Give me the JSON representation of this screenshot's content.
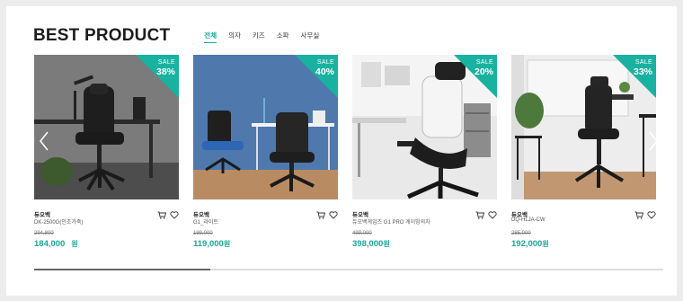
{
  "section": {
    "title": "BEST PRODUCT"
  },
  "tabs": [
    {
      "label": "전체",
      "active": true
    },
    {
      "label": "의자",
      "active": false
    },
    {
      "label": "키즈",
      "active": false
    },
    {
      "label": "소파",
      "active": false
    },
    {
      "label": "사무실",
      "active": false
    }
  ],
  "products": [
    {
      "sale_label": "SALE",
      "sale_pct": "38%",
      "brand": "듀오백",
      "model": "DK-2500G(인조가죽)",
      "original_price": "294,800",
      "price": "184,000",
      "currency": "원"
    },
    {
      "sale_label": "SALE",
      "sale_pct": "40%",
      "brand": "듀오백",
      "model": "G1_라이트",
      "original_price": "199,000",
      "price": "119,000",
      "currency": "원"
    },
    {
      "sale_label": "SALE",
      "sale_pct": "20%",
      "brand": "듀오백",
      "model": "듀오백게임즈 G1 PRO 게이밍의자",
      "original_price": "499,000",
      "price": "398,000",
      "currency": "원"
    },
    {
      "sale_label": "SALE",
      "sale_pct": "33%",
      "brand": "듀오백",
      "model": "DQ-HLJA-CW",
      "original_price": "285,000",
      "price": "192,000",
      "currency": "원"
    }
  ],
  "icons": {
    "cart": "cart-icon",
    "wishlist": "heart-icon",
    "prev": "chevron-left-icon",
    "next": "chevron-right-icon"
  },
  "colors": {
    "accent": "#19b2a1",
    "price": "#19a797",
    "background": "#ececec"
  },
  "carousel": {
    "scroll_progress": 0.28
  }
}
